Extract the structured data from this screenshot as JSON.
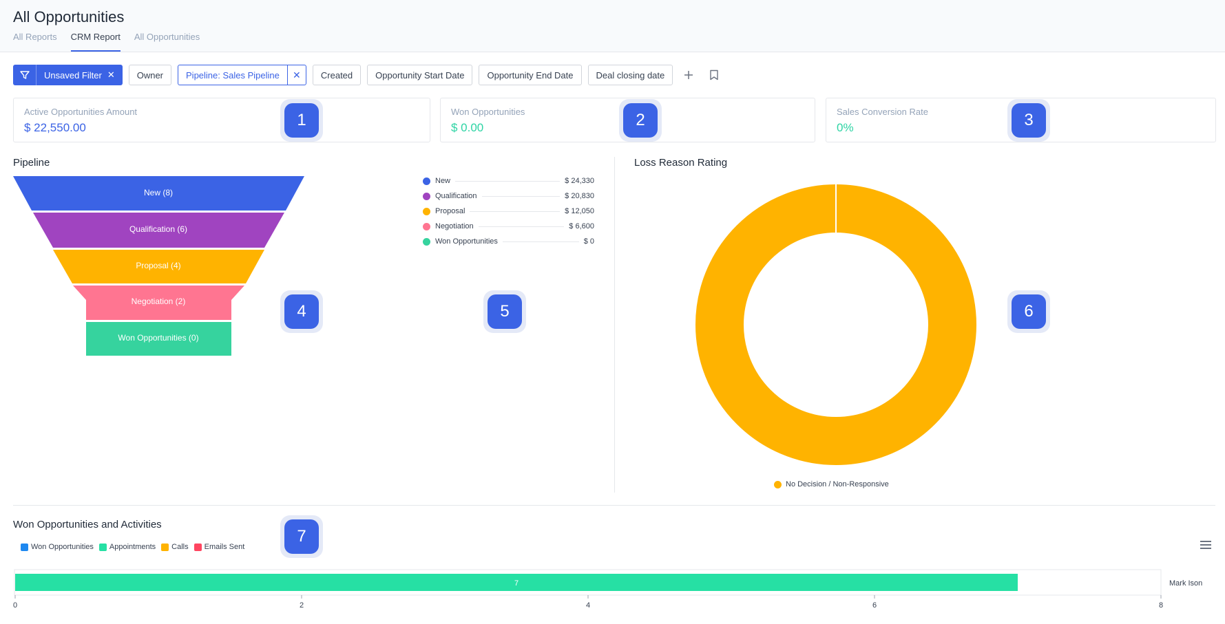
{
  "header": {
    "title": "All Opportunities",
    "tabs": [
      {
        "label": "All Reports"
      },
      {
        "label": "CRM Report"
      },
      {
        "label": "All Opportunities"
      }
    ]
  },
  "filters": {
    "unsaved_label": "Unsaved Filter",
    "owner": "Owner",
    "pipeline": "Pipeline: Sales Pipeline",
    "created": "Created",
    "start_date": "Opportunity Start Date",
    "end_date": "Opportunity End Date",
    "closing_date": "Deal closing date"
  },
  "kpis": [
    {
      "label": "Active Opportunities Amount",
      "value": "$ 22,550.00",
      "color": "#3b63e5"
    },
    {
      "label": "Won Opportunities",
      "value": "$ 0.00",
      "color": "#2dd4a4"
    },
    {
      "label": "Sales Conversion Rate",
      "value": "0%",
      "color": "#2dd4a4"
    }
  ],
  "badges": [
    "1",
    "2",
    "3",
    "4",
    "5",
    "6",
    "7"
  ],
  "pipeline": {
    "title": "Pipeline",
    "stages": [
      {
        "label": "New (8)",
        "color": "#3b63e5"
      },
      {
        "label": "Qualification (6)",
        "color": "#a044c0"
      },
      {
        "label": "Proposal (4)",
        "color": "#ffb300"
      },
      {
        "label": "Negotiation (2)",
        "color": "#ff7591"
      },
      {
        "label": "Won Opportunities (0)",
        "color": "#36d39e"
      }
    ],
    "legend": [
      {
        "name": "New",
        "amount": "$ 24,330",
        "color": "#3b63e5"
      },
      {
        "name": "Qualification",
        "amount": "$ 20,830",
        "color": "#a044c0"
      },
      {
        "name": "Proposal",
        "amount": "$ 12,050",
        "color": "#ffb300"
      },
      {
        "name": "Negotiation",
        "amount": "$ 6,600",
        "color": "#ff7591"
      },
      {
        "name": "Won Opportunities",
        "amount": "$ 0",
        "color": "#36d39e"
      }
    ]
  },
  "loss_reason": {
    "title": "Loss Reason Rating",
    "legend": "No Decision / Non-Responsive",
    "color": "#ffb300"
  },
  "activities": {
    "title": "Won Opportunities and Activities",
    "legend": [
      {
        "name": "Won Opportunities",
        "color": "#1e88f0"
      },
      {
        "name": "Appointments",
        "color": "#26e0a4"
      },
      {
        "name": "Calls",
        "color": "#ffb300"
      },
      {
        "name": "Emails Sent",
        "color": "#ff4560"
      }
    ]
  },
  "chart_data": [
    {
      "type": "bar",
      "title": "Pipeline",
      "categories": [
        "New",
        "Qualification",
        "Proposal",
        "Negotiation",
        "Won Opportunities"
      ],
      "values": [
        8,
        6,
        4,
        2,
        0
      ],
      "amounts": [
        24330,
        20830,
        12050,
        6600,
        0
      ]
    },
    {
      "type": "pie",
      "title": "Loss Reason Rating",
      "categories": [
        "No Decision / Non-Responsive"
      ],
      "values": [
        100
      ]
    },
    {
      "type": "bar",
      "title": "Won Opportunities and Activities",
      "orientation": "horizontal",
      "categories": [
        "Mark Ison"
      ],
      "series": [
        {
          "name": "Appointments",
          "values": [
            7
          ]
        }
      ],
      "xlim": [
        0,
        8
      ],
      "xticks": [
        "0",
        "2",
        "4",
        "6",
        "8"
      ]
    }
  ]
}
